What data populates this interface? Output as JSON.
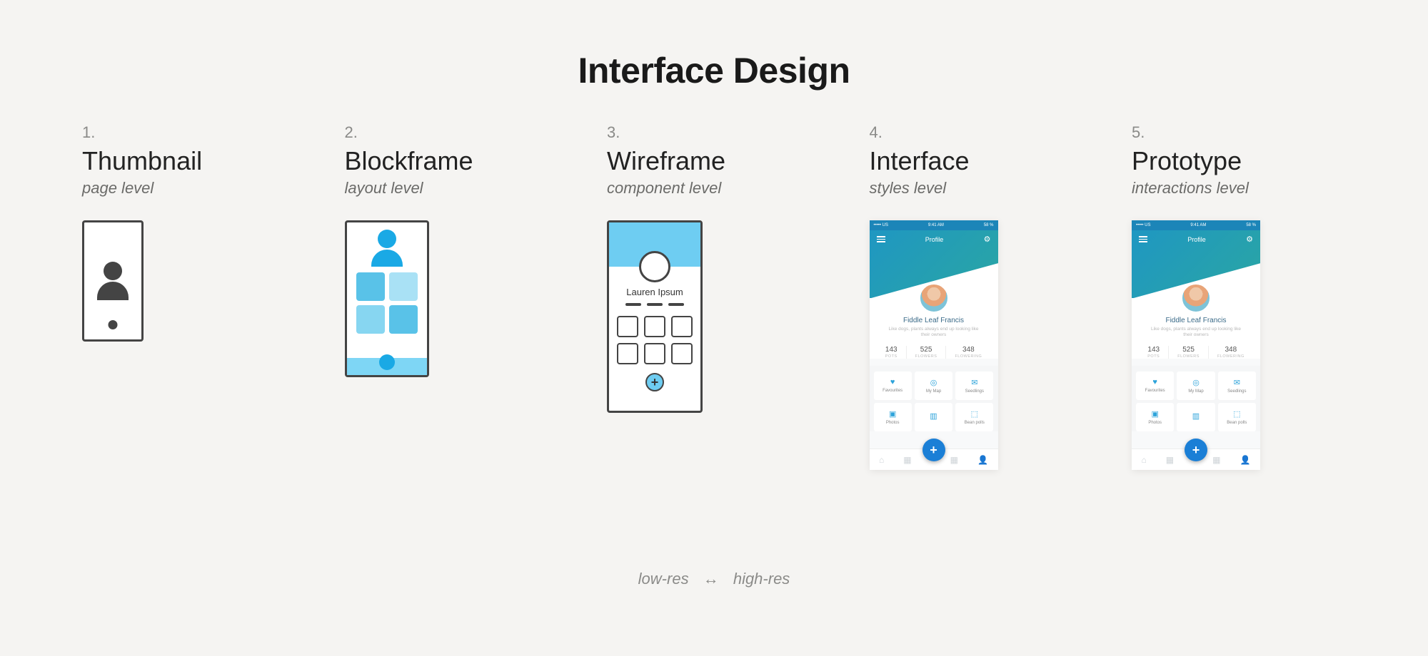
{
  "title": "Interface Design",
  "steps": [
    {
      "num": "1.",
      "label": "Thumbnail",
      "sub": "page level"
    },
    {
      "num": "2.",
      "label": "Blockframe",
      "sub": "layout level"
    },
    {
      "num": "3.",
      "label": "Wireframe",
      "sub": "component level"
    },
    {
      "num": "4.",
      "label": "Interface",
      "sub": "styles level"
    },
    {
      "num": "5.",
      "label": "Prototype",
      "sub": "interactions level"
    }
  ],
  "wireframe": {
    "name": "Lauren Ipsum"
  },
  "mockup": {
    "status_left": "••••• US",
    "status_center": "9:41 AM",
    "status_right": "58 %",
    "header_title": "Profile",
    "username": "Fiddle Leaf Francis",
    "tagline": "Like dogs, plants always end up looking like their owners",
    "stats": [
      {
        "n": "143",
        "l": "POTS"
      },
      {
        "n": "525",
        "l": "FLOWERS"
      },
      {
        "n": "348",
        "l": "FLOWERING"
      }
    ],
    "tiles_row1": [
      {
        "icon": "♥",
        "label": "Favourites"
      },
      {
        "icon": "◎",
        "label": "My Map"
      },
      {
        "icon": "✉",
        "label": "Seedlings"
      }
    ],
    "tiles_row2": [
      {
        "icon": "▣",
        "label": "Photos"
      },
      {
        "icon": "▥",
        "label": ""
      },
      {
        "icon": "⬚",
        "label": "Bean polls"
      }
    ],
    "fab": "+"
  },
  "footer": {
    "left": "low-res",
    "arrow": "↔",
    "right": "high-res"
  }
}
